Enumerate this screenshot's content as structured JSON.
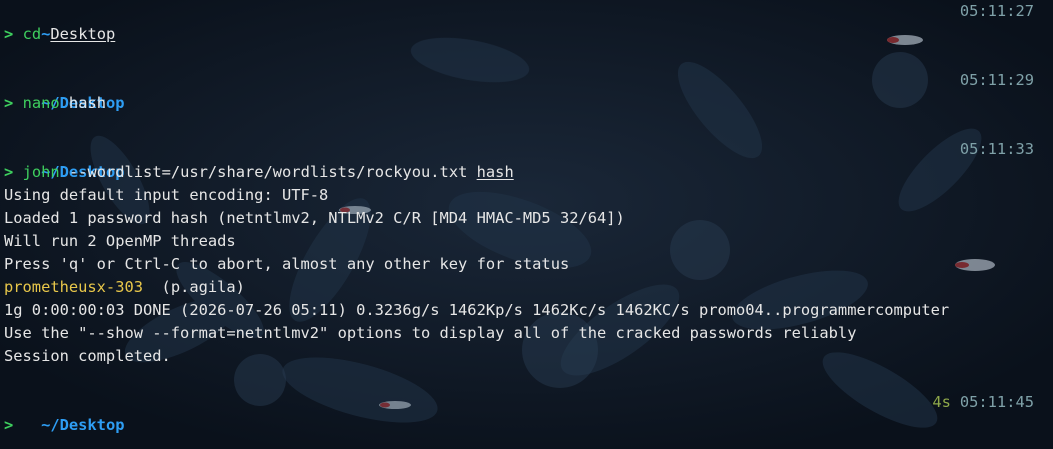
{
  "colors": {
    "background": "#0c1420",
    "cwd": "#2e9ef4",
    "timestamp": "#7fa1a8",
    "prompt": "#3ecf5e",
    "password": "#e8c74a",
    "duration": "#8ea84a"
  },
  "blocks": [
    {
      "cwd": "~",
      "time": "05:11:27",
      "prompt": ">",
      "cmd": "cd",
      "args": [
        "Desktop"
      ],
      "output": []
    },
    {
      "cwd": "~/Desktop",
      "time": "05:11:29",
      "prompt": ">",
      "cmd": "nano",
      "args": [
        "hash"
      ],
      "output": []
    },
    {
      "cwd": "~/Desktop",
      "time": "05:11:33",
      "prompt": ">",
      "cmd": "john",
      "args": [
        "--wordlist=/usr/share/wordlists/rockyou.txt",
        "hash"
      ],
      "output": [
        "Using default input encoding: UTF-8",
        "Loaded 1 password hash (netntlmv2, NTLMv2 C/R [MD4 HMAC-MD5 32/64])",
        "Will run 2 OpenMP threads",
        "Press 'q' or Ctrl-C to abort, almost any other key for status"
      ],
      "cracked": {
        "password": "prometheusx-303",
        "user": "(p.agila)"
      },
      "output_after": [
        "1g 0:00:00:03 DONE (2026-07-26 05:11) 0.3236g/s 1462Kp/s 1462Kc/s 1462KC/s promo04..programmercomputer",
        "Use the \"--show --format=netntlmv2\" options to display all of the cracked passwords reliably",
        "Session completed."
      ]
    },
    {
      "cwd": "~/Desktop",
      "duration": "4s",
      "time": "05:11:45",
      "prompt": ">"
    }
  ]
}
